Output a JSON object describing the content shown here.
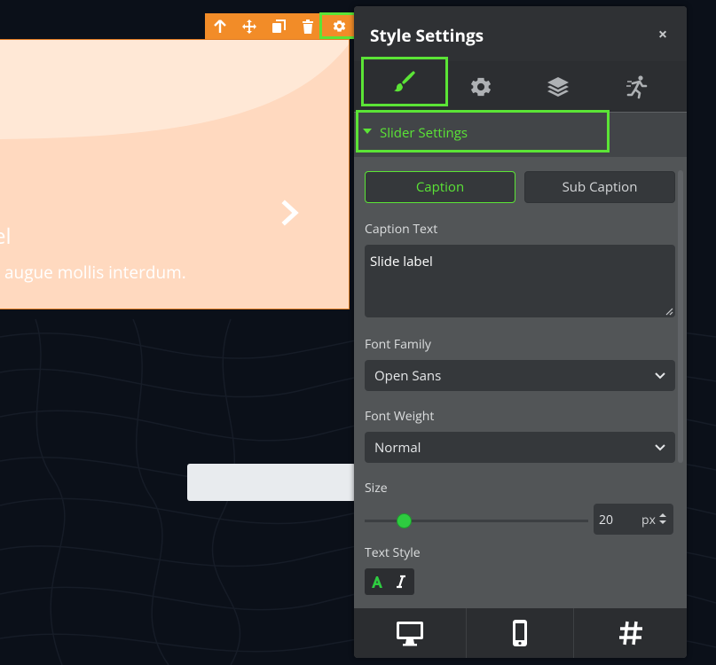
{
  "colors": {
    "accent": "#5be436",
    "toolbar": "#f28c28",
    "panel": "#525557",
    "slide": "#ffd9bf"
  },
  "slide": {
    "label": "el",
    "text": "augue mollis interdum.",
    "next_icon": "chevron-right-icon"
  },
  "toolbar": {
    "items": [
      "arrow-up-icon",
      "move-icon",
      "copy-icon",
      "trash-icon",
      "gear-icon"
    ]
  },
  "panel": {
    "title": "Style Settings",
    "close": "×",
    "tabs": [
      "brush-icon",
      "gear-icon",
      "layers-icon",
      "animation-icon"
    ],
    "active_tab": "brush-icon",
    "section": "Slider Settings",
    "caption_tabs": {
      "caption": "Caption",
      "sub_caption": "Sub Caption",
      "active": "Caption"
    },
    "caption_text": {
      "label": "Caption Text",
      "value": "Slide label"
    },
    "font_family": {
      "label": "Font Family",
      "value": "Open Sans"
    },
    "font_weight": {
      "label": "Font Weight",
      "value": "Normal"
    },
    "size": {
      "label": "Size",
      "value": "20",
      "unit": "px"
    },
    "text_style": {
      "label": "Text Style",
      "buttons": [
        "A",
        "I"
      ]
    },
    "footer": [
      "desktop-icon",
      "mobile-icon",
      "hash-icon"
    ]
  }
}
